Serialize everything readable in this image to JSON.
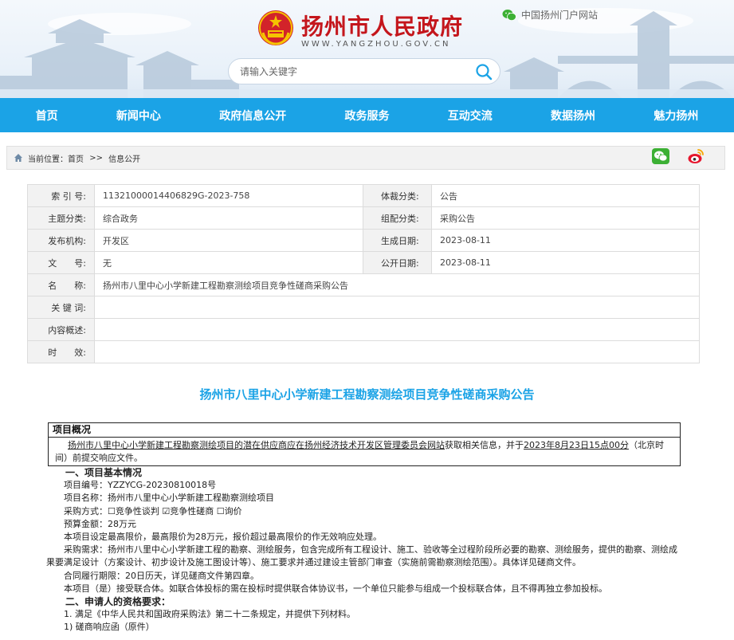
{
  "header": {
    "site_title": "扬州市人民政府",
    "site_domain": "WWW.YANGZHOU.GOV.CN",
    "portal_link": "中国扬州门户网站",
    "search_placeholder": "请输入关键字"
  },
  "nav": {
    "items": [
      "首页",
      "新闻中心",
      "政府信息公开",
      "政务服务",
      "互动交流",
      "数据扬州",
      "魅力扬州"
    ]
  },
  "breadcrumb": {
    "prefix": "当前位置：",
    "home": "首页",
    "sep": ">>",
    "current": "信息公开"
  },
  "meta": {
    "index_label": "索 引 号:",
    "index_value": "11321000014406829G-2023-758",
    "genre_label": "体裁分类:",
    "genre_value": "公告",
    "topic_label": "主题分类:",
    "topic_value": "综合政务",
    "org_label": "组配分类:",
    "org_value": "采购公告",
    "issuer_label": "发布机构:",
    "issuer_value": "开发区",
    "created_label": "生成日期:",
    "created_value": "2023-08-11",
    "docno_label": "文　　号:",
    "docno_value": "无",
    "public_label": "公开日期:",
    "public_value": "2023-08-11",
    "name_label": "名　　称:",
    "name_value": "扬州市八里中心小学新建工程勘察测绘项目竞争性磋商采购公告",
    "keywords_label": "关 键 词:",
    "keywords_value": "",
    "summary_label": "内容概述:",
    "summary_value": "",
    "validity_label": "时　　效:",
    "validity_value": ""
  },
  "article": {
    "title": "扬州市八里中心小学新建工程勘察测绘项目竞争性磋商采购公告",
    "overview_heading": "项目概况",
    "intro_1": "扬州市八里中心小学新建工程勘察测绘项目的潜在供应商应在",
    "intro_link": "扬州经济技术开发区管理委员会网站",
    "intro_2": "获取相关信息，并于",
    "intro_deadline": "2023年8月23日15点00分",
    "intro_3": "（北京时间）前提交响应文件。",
    "s1_heading": "一、项目基本情况",
    "p_no": "项目编号：YZZYCG-20230810018号",
    "p_name": "项目名称：扬州市八里中心小学新建工程勘察测绘项目",
    "p_method": "采购方式：☐竞争性谈判 ☑竞争性磋商 ☐询价",
    "p_budget": "预算金额：28万元",
    "p_limit": "本项目设定最高限价，最高限价为28万元，报价超过最高限价的作无效响应处理。",
    "p_need": "采购需求：扬州市八里中心小学新建工程的勘察、测绘服务，包含完成所有工程设计、施工、验收等全过程阶段所必要的勘察、测绘服务，提供的勘察、测绘成果要满足设计（方案设计、初步设计及施工图设计等）、施工要求并通过建设主管部门审查（实施前需勘察测绘范围）。具体详见磋商文件。",
    "p_period": "合同履行期限：20日历天，详见磋商文件第四章。",
    "p_joint": "本项目（是）接受联合体。如联合体投标的需在投标时提供联合体协议书，一个单位只能参与组成一个投标联合体，且不得再独立参加投标。",
    "s2_heading": "二、申请人的资格要求：",
    "r1": "1. 满足《中华人民共和国政府采购法》第二十二条规定，并提供下列材料。",
    "r1_1": "1) 磋商响应函（原件）"
  },
  "colors": {
    "nav_bg": "#1ba3e6",
    "title_red": "#c4161c",
    "article_title": "#1ba3e6"
  },
  "icons": [
    "national-emblem-icon",
    "wechat-icon",
    "search-icon",
    "home-icon",
    "wechat-share-icon",
    "weibo-share-icon"
  ]
}
